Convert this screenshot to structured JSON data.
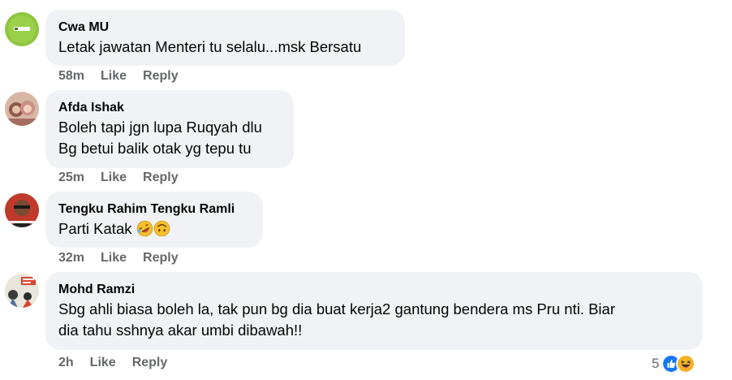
{
  "comments": [
    {
      "author": "Cwa MU",
      "lines": [
        "Letak jawatan Menteri tu selalu...msk Bersatu"
      ],
      "time": "58m",
      "like": "Like",
      "reply": "Reply",
      "avatar_icon": "green-logo-avatar"
    },
    {
      "author": "Afda Ishak",
      "lines": [
        "Boleh tapi jgn lupa Ruqyah dlu",
        "Bg betui balik otak yg tepu tu"
      ],
      "time": "25m",
      "like": "Like",
      "reply": "Reply",
      "avatar_icon": "photo-avatar"
    },
    {
      "author": "Tengku Rahim Tengku Ramli",
      "lines": [
        "Parti Katak"
      ],
      "emojis": [
        "rolling-laughing-emoji",
        "upside-down-face-emoji"
      ],
      "time": "32m",
      "like": "Like",
      "reply": "Reply",
      "avatar_icon": "photo-avatar"
    },
    {
      "author": "Mohd Ramzi",
      "lines": [
        "Sbg ahli biasa boleh la, tak pun bg dia buat kerja2 gantung bendera ms Pru nti. Biar",
        "dia tahu sshnya akar umbi dibawah!!"
      ],
      "time": "2h",
      "like": "Like",
      "reply": "Reply",
      "avatar_icon": "graphic-avatar",
      "reactions": {
        "count": "5",
        "icons": [
          "like-reaction-icon",
          "haha-reaction-icon"
        ]
      }
    }
  ],
  "colors": {
    "bubble": "#f0f2f5",
    "meta_text": "#65676b",
    "like_blue": "#1877f2",
    "haha_yellow": "#f7b125"
  }
}
